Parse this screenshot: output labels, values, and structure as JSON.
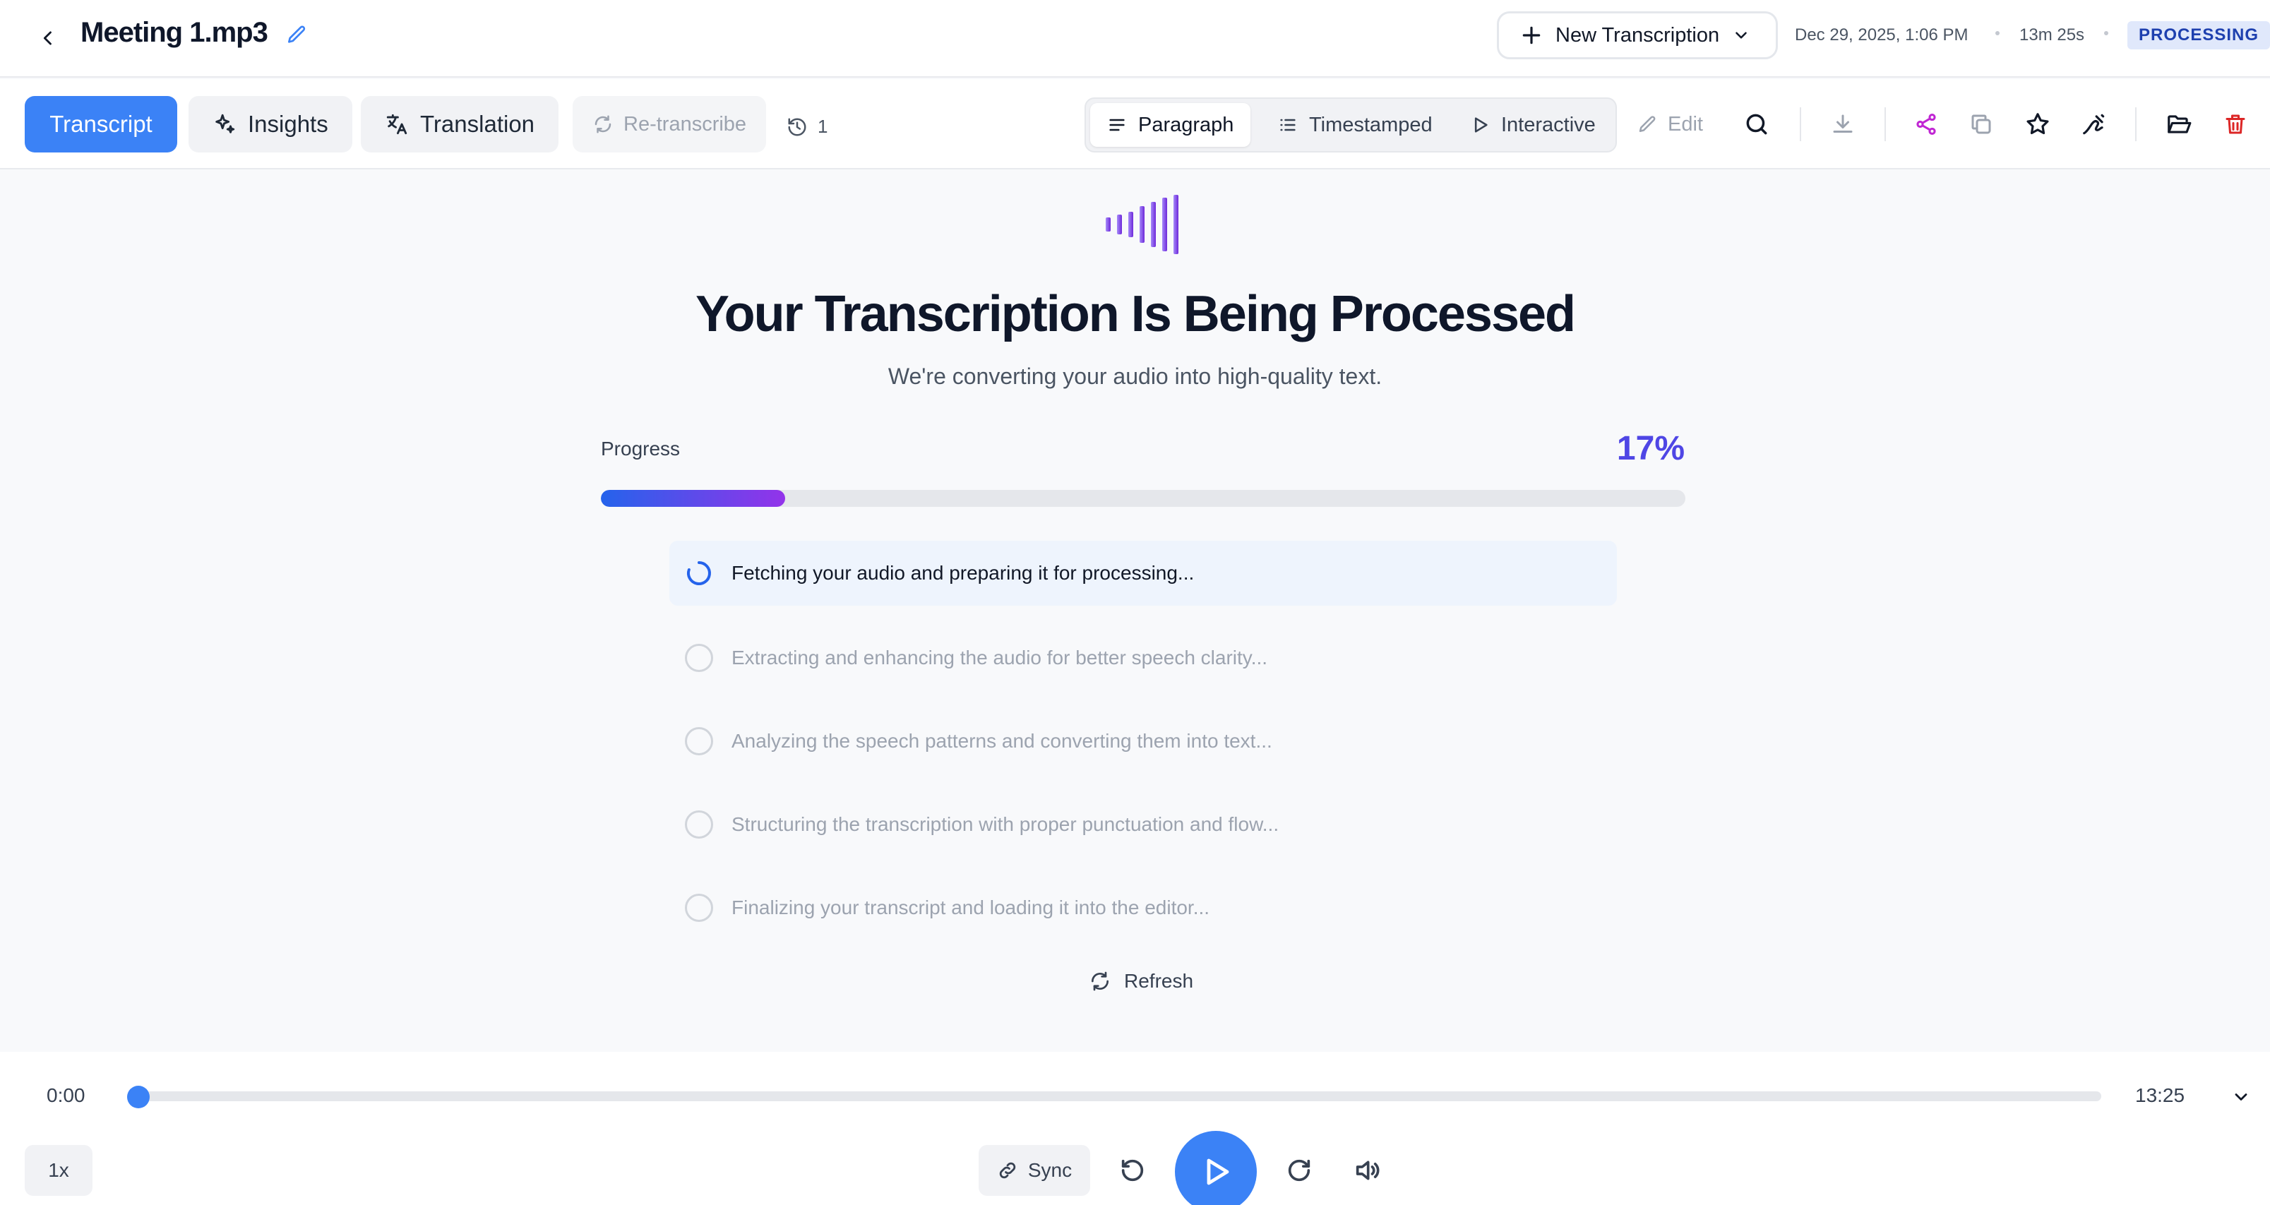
{
  "header": {
    "file_name": "Meeting 1.mp3",
    "new_transcription_label": "New Transcription",
    "date": "Dec 29, 2025, 1:06 PM",
    "duration": "13m 25s",
    "status": "PROCESSING"
  },
  "toolbar": {
    "tabs": [
      {
        "label": "Transcript",
        "icon": "document-icon"
      },
      {
        "label": "Insights",
        "icon": "sparkle-icon"
      },
      {
        "label": "Translation",
        "icon": "translate-icon"
      }
    ],
    "retranscribe_label": "Re-transcribe",
    "history_count": "1",
    "view_modes": [
      {
        "label": "Paragraph",
        "icon": "paragraph-icon"
      },
      {
        "label": "Timestamped",
        "icon": "list-icon"
      },
      {
        "label": "Interactive",
        "icon": "play-outline-icon"
      }
    ],
    "edit_label": "Edit"
  },
  "main": {
    "title": "Your Transcription Is Being Processed",
    "subtitle": "We're converting your audio into high-quality text.",
    "progress_label": "Progress",
    "progress_percent_text": "17%",
    "progress_fraction": 0.17,
    "steps": [
      {
        "text": "Fetching your audio and preparing it for processing...",
        "state": "current"
      },
      {
        "text": "Extracting and enhancing the audio for better speech clarity...",
        "state": "pending"
      },
      {
        "text": "Analyzing the speech patterns and converting them into text...",
        "state": "pending"
      },
      {
        "text": "Structuring the transcription with proper punctuation and flow...",
        "state": "pending"
      },
      {
        "text": "Finalizing your transcript and loading it into the editor...",
        "state": "pending"
      }
    ],
    "refresh_label": "Refresh"
  },
  "player": {
    "current_time": "0:00",
    "total_time": "13:25",
    "speed": "1x",
    "sync_label": "Sync"
  },
  "colors": {
    "accent": "#3b82f6",
    "progress_start": "#2563eb",
    "progress_end": "#9333ea",
    "share": "#c026d3",
    "delete": "#dc2626"
  }
}
